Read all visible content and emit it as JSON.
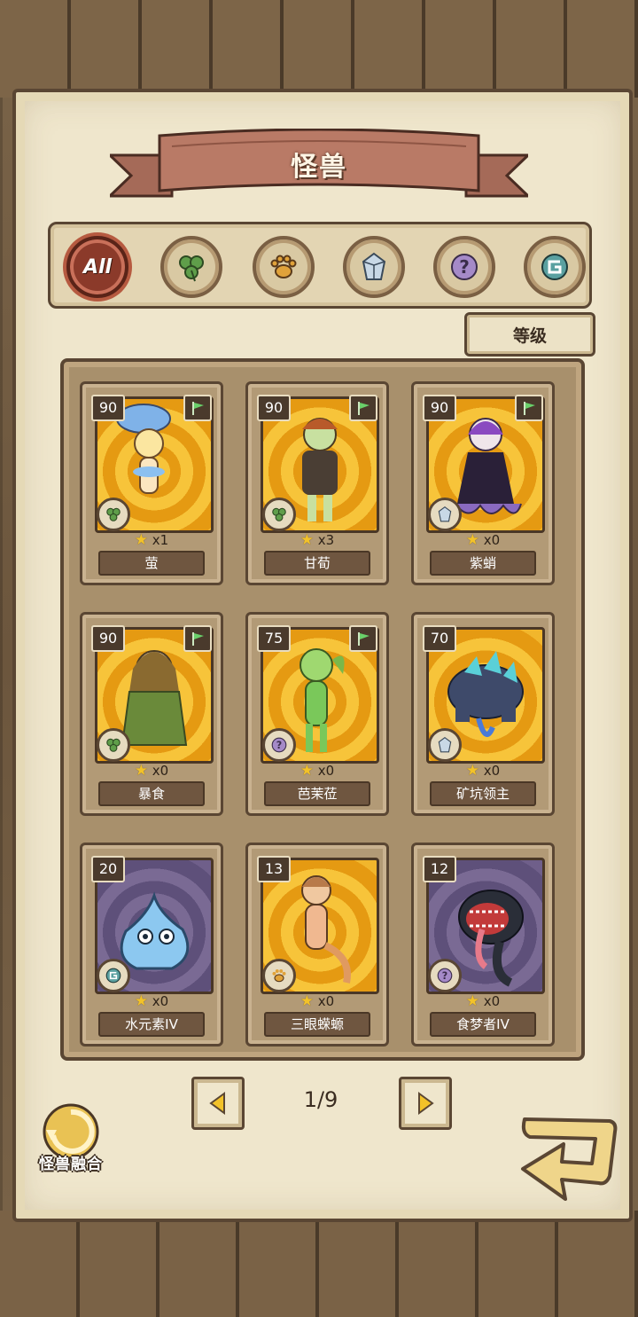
{
  "title": "怪兽",
  "filters": [
    {
      "id": "all",
      "label": "All",
      "icon": "all-icon",
      "active": true
    },
    {
      "id": "plant",
      "icon": "clover-icon",
      "active": false
    },
    {
      "id": "beast",
      "icon": "paw-icon",
      "active": false
    },
    {
      "id": "mineral",
      "icon": "crystal-icon",
      "active": false
    },
    {
      "id": "unknown",
      "icon": "question-icon",
      "active": false
    },
    {
      "id": "element",
      "icon": "swirl-icon",
      "active": false
    }
  ],
  "sort_label": "等级",
  "cards": [
    {
      "level": "90",
      "count": "x1",
      "name": "萤",
      "type": "clover-icon",
      "flag": true,
      "bg": "gold"
    },
    {
      "level": "90",
      "count": "x3",
      "name": "甘荀",
      "type": "clover-icon",
      "flag": true,
      "bg": "gold"
    },
    {
      "level": "90",
      "count": "x0",
      "name": "紫蛸",
      "type": "crystal-icon",
      "flag": true,
      "bg": "gold"
    },
    {
      "level": "90",
      "count": "x0",
      "name": "暴食",
      "type": "clover-icon",
      "flag": true,
      "bg": "gold"
    },
    {
      "level": "75",
      "count": "x0",
      "name": "芭茉莅",
      "type": "question-icon",
      "flag": true,
      "bg": "gold"
    },
    {
      "level": "70",
      "count": "x0",
      "name": "矿坑领主",
      "type": "crystal-icon",
      "flag": false,
      "bg": "gold"
    },
    {
      "level": "20",
      "count": "x0",
      "name": "水元素IV",
      "type": "swirl-icon",
      "flag": false,
      "bg": "purple"
    },
    {
      "level": "13",
      "count": "x0",
      "name": "三眼蝾螈",
      "type": "paw-icon",
      "flag": false,
      "bg": "gold"
    },
    {
      "level": "12",
      "count": "x0",
      "name": "食梦者IV",
      "type": "question-icon",
      "flag": false,
      "bg": "purple"
    }
  ],
  "pager": {
    "text": "1/9"
  },
  "fusion_label": "怪兽融合",
  "colors": {
    "accent": "#8b3a2a",
    "paper": "#efe6cc",
    "wood": "#6f5a42",
    "star": "#f2c229"
  }
}
